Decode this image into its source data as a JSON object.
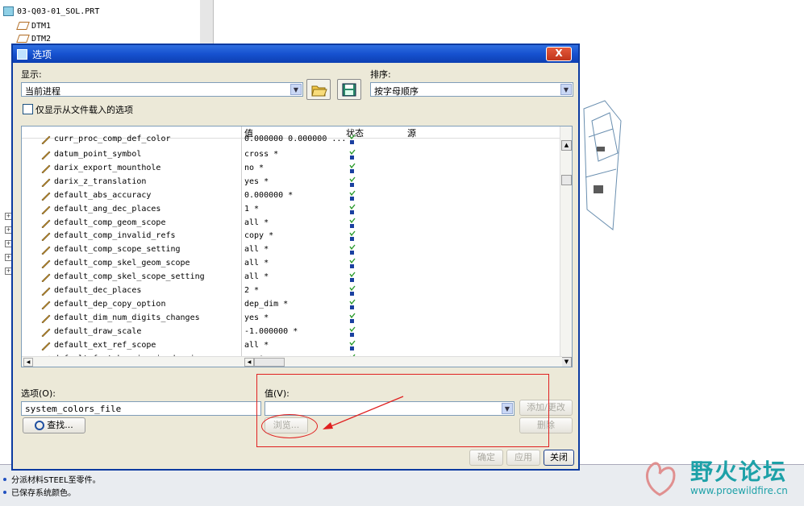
{
  "background_app": {
    "model_tree": {
      "root": "03-Q03-01_SOL.PRT",
      "items": [
        "DTM1",
        "DTM2"
      ]
    },
    "status_messages": [
      "分派材料STEEL至零件。",
      "已保存系统颜色。"
    ]
  },
  "dialog": {
    "title": "选项",
    "close_label": "X",
    "display_label": "显示:",
    "display_value": "当前进程",
    "sort_label": "排序:",
    "sort_value": "按字母顺序",
    "only_loaded_label": "仅显示从文件载入的选项",
    "columns": {
      "value": "值",
      "status": "状态",
      "source": "源"
    },
    "partial_row": {
      "name": "curr_proc_comp_def_color",
      "value": "0.000000 0.000000 ..."
    },
    "rows": [
      {
        "name": "datum_point_symbol",
        "value": "cross *"
      },
      {
        "name": "darix_export_mounthole",
        "value": "no *"
      },
      {
        "name": "darix_z_translation",
        "value": "yes *"
      },
      {
        "name": "default_abs_accuracy",
        "value": "0.000000 *"
      },
      {
        "name": "default_ang_dec_places",
        "value": "1 *"
      },
      {
        "name": "default_comp_geom_scope",
        "value": "all *"
      },
      {
        "name": "default_comp_invalid_refs",
        "value": "copy *"
      },
      {
        "name": "default_comp_scope_setting",
        "value": "all *"
      },
      {
        "name": "default_comp_skel_geom_scope",
        "value": "all *"
      },
      {
        "name": "default_comp_skel_scope_setting",
        "value": "all *"
      },
      {
        "name": "default_dec_places",
        "value": "2 *"
      },
      {
        "name": "default_dep_copy_option",
        "value": "dep_dim *"
      },
      {
        "name": "default_dim_num_digits_changes",
        "value": "yes *"
      },
      {
        "name": "default_draw_scale",
        "value": "-1.000000 *"
      },
      {
        "name": "default_ext_ref_scope",
        "value": "all *"
      },
      {
        "name": "default_font_kerning_in_drawing",
        "value": "no *"
      }
    ],
    "option_label": "选项(O):",
    "option_value": "system_colors_file",
    "value_label": "值(V):",
    "add_change_label": "添加/更改",
    "find_label": "查找...",
    "browse_label": "浏览...",
    "delete_label": "删除",
    "ok_label": "确定",
    "apply_label": "应用",
    "close_button_label": "关闭"
  },
  "watermark": {
    "name": "野火论坛",
    "url": "www.proewildfire.cn"
  },
  "colors": {
    "title_bar": "#1651cf",
    "dialog_bg": "#ece9d8",
    "annotation": "#e02020",
    "watermark": "#1da1a8"
  }
}
